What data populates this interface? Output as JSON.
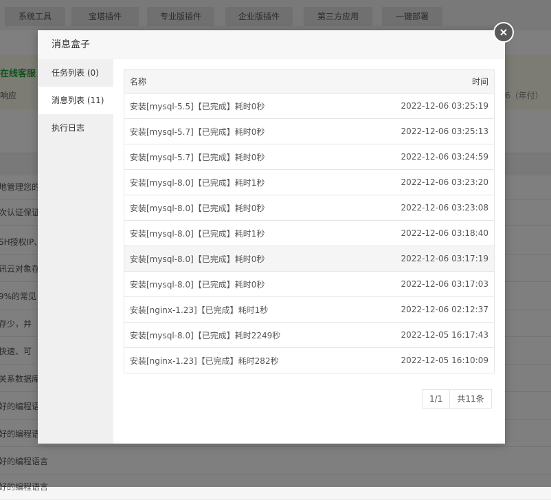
{
  "background": {
    "top_tabs": [
      "系统工具",
      "宝塔插件",
      "专业版插件",
      "企业版插件",
      "第三方应用",
      "一键部署"
    ],
    "banner_title": "在线客服",
    "banner_sub": "响应",
    "banner_right": "6（年付）",
    "rows": [
      "地管理您的",
      "次认证保证",
      "SH授权IP、",
      "讯云对象存",
      "9%的常见",
      "存少，并",
      "快速、可",
      "关系数据库",
      "好的编程语",
      "好的编程语",
      "好的编程语言",
      "好的编程语言"
    ]
  },
  "modal": {
    "title": "消息盒子",
    "close_symbol": "×",
    "nav": [
      {
        "label": "任务列表 (0)"
      },
      {
        "label": "消息列表 (11)"
      },
      {
        "label": "执行日志"
      }
    ],
    "table": {
      "col_name": "名称",
      "col_time": "时间",
      "rows": [
        {
          "name": "安装[mysql-5.5]【已完成】耗时0秒",
          "time": "2022-12-06 03:25:19"
        },
        {
          "name": "安装[mysql-5.7]【已完成】耗时0秒",
          "time": "2022-12-06 03:25:13"
        },
        {
          "name": "安装[mysql-5.7]【已完成】耗时0秒",
          "time": "2022-12-06 03:24:59"
        },
        {
          "name": "安装[mysql-8.0]【已完成】耗时1秒",
          "time": "2022-12-06 03:23:20"
        },
        {
          "name": "安装[mysql-8.0]【已完成】耗时0秒",
          "time": "2022-12-06 03:23:08"
        },
        {
          "name": "安装[mysql-8.0]【已完成】耗时1秒",
          "time": "2022-12-06 03:18:40"
        },
        {
          "name": "安装[mysql-8.0]【已完成】耗时0秒",
          "time": "2022-12-06 03:17:19"
        },
        {
          "name": "安装[mysql-8.0]【已完成】耗时0秒",
          "time": "2022-12-06 03:17:03"
        },
        {
          "name": "安装[nginx-1.23]【已完成】耗时1秒",
          "time": "2022-12-06 02:12:37"
        },
        {
          "name": "安装[mysql-8.0]【已完成】耗时2249秒",
          "time": "2022-12-05 16:17:43"
        },
        {
          "name": "安装[nginx-1.23]【已完成】耗时282秒",
          "time": "2022-12-05 16:10:09"
        }
      ]
    },
    "pager": {
      "page": "1/1",
      "total": "共11条"
    }
  }
}
